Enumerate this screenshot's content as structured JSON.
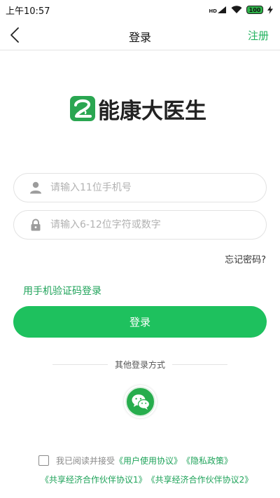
{
  "status_bar": {
    "time": "上午10:57",
    "network_label": "HD",
    "battery": "100",
    "icons": [
      "signal-icon",
      "wifi-icon",
      "battery-icon",
      "charging-icon"
    ]
  },
  "nav": {
    "title": "登录",
    "register_label": "注册",
    "back_icon": "chevron-left-icon"
  },
  "logo": {
    "brand_text": "能康大医生"
  },
  "form": {
    "phone_placeholder": "请输入11位手机号",
    "password_placeholder": "请输入6-12位字符或数字",
    "forgot_label": "忘记密码?",
    "sms_login_label": "用手机验证码登录",
    "login_label": "登录"
  },
  "other_login": {
    "label": "其他登录方式",
    "wechat_icon": "wechat-icon"
  },
  "agreement": {
    "prefix": "我已阅读并接受",
    "user_agreement": "《用户使用协议》",
    "privacy_policy": "《隐私政策》",
    "partner_agreement_1": "《共享经济合作伙伴协议1》",
    "partner_agreement_2": "《共享经济合作伙伴协议2》",
    "checked": false
  },
  "colors": {
    "accent": "#1ec15e",
    "link": "#1fa35a",
    "wechat": "#27ad4d"
  }
}
